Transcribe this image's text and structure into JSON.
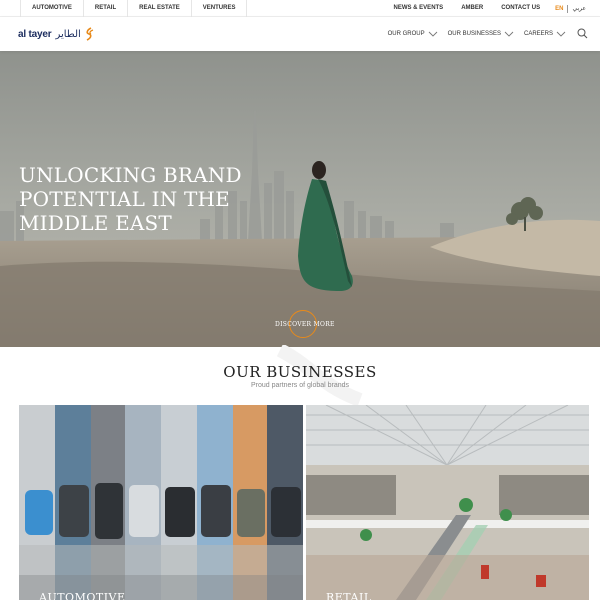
{
  "topbar": {
    "left_links": [
      "AUTOMOTIVE",
      "RETAIL",
      "REAL ESTATE",
      "VENTURES"
    ],
    "right_links": [
      "NEWS & EVENTS",
      "AMBER",
      "CONTACT US"
    ],
    "lang_en": "EN",
    "lang_ar": "عربي"
  },
  "logo": {
    "latin": "al tayer",
    "arabic": "الطاير"
  },
  "nav": {
    "items": [
      "OUR GROUP",
      "OUR BUSINESSES",
      "CAREERS"
    ]
  },
  "hero": {
    "title": "UNLOCKING BRAND POTENTIAL IN THE MIDDLE EAST",
    "cta": "DISCOVER MORE"
  },
  "businesses": {
    "title": "OUR BUSINESSES",
    "subtitle": "Proud partners of global brands",
    "cards": [
      "AUTOMOTIVE",
      "RETAIL"
    ]
  },
  "colors": {
    "accent": "#e88a1a",
    "brand_navy": "#1b2c5e"
  }
}
